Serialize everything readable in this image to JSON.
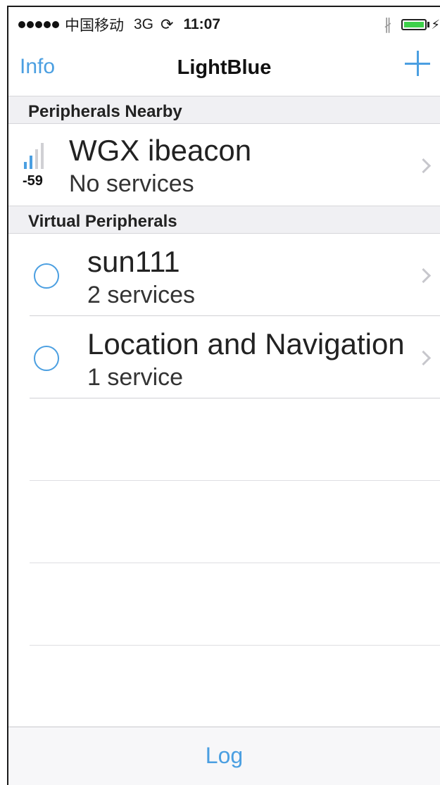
{
  "status_bar": {
    "carrier": "中国移动",
    "network": "3G",
    "sync_symbol": "⟳",
    "time": "11:07",
    "bluetooth_symbol": "∦",
    "charging_symbol": "⚡"
  },
  "nav": {
    "left_label": "Info",
    "title": "LightBlue"
  },
  "sections": {
    "nearby": {
      "label": "Peripherals Nearby"
    },
    "virtual": {
      "label": "Virtual Peripherals"
    }
  },
  "nearby_peripherals": [
    {
      "name": "WGX ibeacon",
      "detail": "No services",
      "rssi": "-59",
      "signal_level": 0.5
    }
  ],
  "virtual_peripherals": [
    {
      "name": "sun111",
      "detail": "2 services"
    },
    {
      "name": "Location and Navigation",
      "detail": "1 service"
    }
  ],
  "toolbar": {
    "log_label": "Log"
  },
  "colors": {
    "accent": "#4b9fe1",
    "signal_active": "#4b9fe1",
    "signal_inactive": "#d0d0d4",
    "battery_fill": "#3dd04a"
  }
}
